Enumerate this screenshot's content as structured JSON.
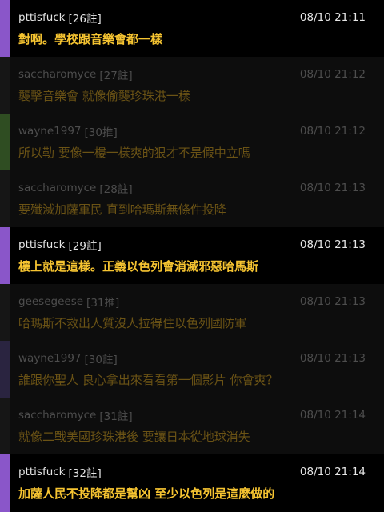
{
  "comments": [
    {
      "author": "pttisfuck",
      "floor": "[26註]",
      "time": "08/10 21:11",
      "text": "對啊。學校跟音樂會都一樣",
      "state": "bright",
      "accent": "#8a56c9"
    },
    {
      "author": "saccharomyce",
      "floor": "[27註]",
      "time": "08/10 21:12",
      "text": "襲擊音樂會 就像偷襲珍珠港一樣",
      "state": "dim",
      "accent": "#161616"
    },
    {
      "author": "wayne1997",
      "floor": "[30推]",
      "time": "08/10 21:12",
      "text": "所以勒 要像一樓一樣爽的狠才不是假中立嗎",
      "state": "dim",
      "accent": "#2f4d22"
    },
    {
      "author": "saccharomyce",
      "floor": "[28註]",
      "time": "08/10 21:13",
      "text": "要殲滅加薩軍民 直到哈瑪斯無條件投降",
      "state": "dim",
      "accent": "#161616"
    },
    {
      "author": "pttisfuck",
      "floor": "[29註]",
      "time": "08/10 21:13",
      "text": "樓上就是這樣。正義以色列會消滅邪惡哈馬斯",
      "state": "bright",
      "accent": "#8a56c9"
    },
    {
      "author": "geesegeese",
      "floor": "[31推]",
      "time": "08/10 21:13",
      "text": "哈瑪斯不救出人質沒人拉得住以色列國防軍",
      "state": "dim",
      "accent": "#161616"
    },
    {
      "author": "wayne1997",
      "floor": "[30註]",
      "time": "08/10 21:13",
      "text": "誰跟你聖人 良心拿出來看看第一個影片 你會爽？",
      "state": "dim",
      "accent": "#2a2440"
    },
    {
      "author": "saccharomyce",
      "floor": "[31註]",
      "time": "08/10 21:14",
      "text": "就像二戰美國珍珠港後 要讓日本從地球消失",
      "state": "dim",
      "accent": "#161616"
    },
    {
      "author": "pttisfuck",
      "floor": "[32註]",
      "time": "08/10 21:14",
      "text": "加薩人民不投降都是幫凶 至少以色列是這麼做的",
      "state": "bright",
      "accent": "#8a56c9"
    }
  ]
}
